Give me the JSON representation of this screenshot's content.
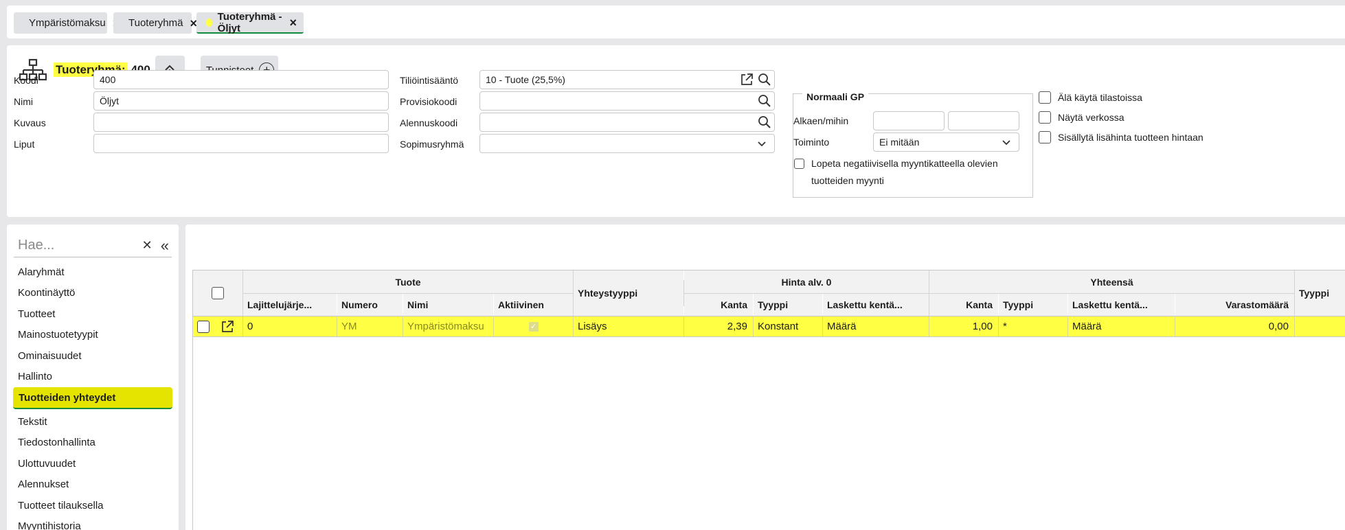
{
  "tabs": [
    {
      "label": "Ympäristömaksu",
      "active": false
    },
    {
      "label": "Tuoteryhmä",
      "active": false
    },
    {
      "label": "Tuoteryhmä - Öljyt",
      "active": true
    }
  ],
  "header": {
    "title_prefix": "Tuoteryhmä:",
    "title_value": "400",
    "tags_label": "Tunnisteet"
  },
  "form": {
    "koodi_label": "Koodi",
    "koodi_value": "400",
    "nimi_label": "Nimi",
    "nimi_value": "Öljyt",
    "kuvaus_label": "Kuvaus",
    "kuvaus_value": "",
    "liput_label": "Liput",
    "liput_value": "",
    "tilioint_label": "Tiliöintisääntö",
    "tilioint_value": "10 - Tuote (25,5%)",
    "provisio_label": "Provisiokoodi",
    "provisio_value": "",
    "alennus_label": "Alennuskoodi",
    "alennus_value": "",
    "sopimus_label": "Sopimusryhmä",
    "sopimus_value": ""
  },
  "gp": {
    "legend": "Normaali GP",
    "alkaen_label": "Alkaen/mihin",
    "toiminto_label": "Toiminto",
    "toiminto_value": "Ei mitään",
    "lopeta_label_1": "Lopeta negatiivisella myyntikatteella olevien",
    "lopeta_label_2": "tuotteiden myynti"
  },
  "options": {
    "ala_kayta": "Älä käytä tilastoissa",
    "nayta_verkossa": "Näytä verkossa",
    "sisallyta": "Sisällytä lisähinta tuotteen hintaan"
  },
  "sidebar": {
    "search_placeholder": "Hae...",
    "items": [
      {
        "label": "Alaryhmät"
      },
      {
        "label": "Koontinäyttö"
      },
      {
        "label": "Tuotteet"
      },
      {
        "label": "Mainostuotetyypit"
      },
      {
        "label": "Ominaisuudet"
      },
      {
        "label": "Hallinto"
      },
      {
        "label": "Tuotteiden yhteydet",
        "active": true
      },
      {
        "label": "Tekstit"
      },
      {
        "label": "Tiedostonhallinta"
      },
      {
        "label": "Ulottuvuudet"
      },
      {
        "label": "Alennukset"
      },
      {
        "label": "Tuotteet tilauksella"
      },
      {
        "label": "Myyntihistoria"
      }
    ]
  },
  "grid": {
    "group_tuote": "Tuote",
    "group_yhteystyyppi": "Yhteystyyppi",
    "group_hinta": "Hinta alv. 0",
    "group_yhteensa": "Yhteensä",
    "group_tyyppi": "Tyyppi",
    "columns": {
      "lajittelu": "Lajittelujärje...",
      "numero": "Numero",
      "nimi": "Nimi",
      "aktiivinen": "Aktiivinen",
      "kanta1": "Kanta",
      "tyyppi1": "Tyyppi",
      "laskettu1": "Laskettu kentä...",
      "kanta2": "Kanta",
      "tyyppi2": "Tyyppi",
      "laskettu2": "Laskettu kentä...",
      "varasto": "Varastomäärä"
    },
    "rows": [
      {
        "lajittelu": "0",
        "numero": "YM",
        "nimi": "Ympäristömaksu",
        "aktiivinen": true,
        "yhteystyyppi": "Lisäys",
        "kanta1": "2,39",
        "tyyppi1": "Konstant",
        "laskettu1": "Määrä",
        "kanta2": "1,00",
        "tyyppi2": "*",
        "laskettu2": "Määrä",
        "varasto": "0,00"
      }
    ]
  }
}
